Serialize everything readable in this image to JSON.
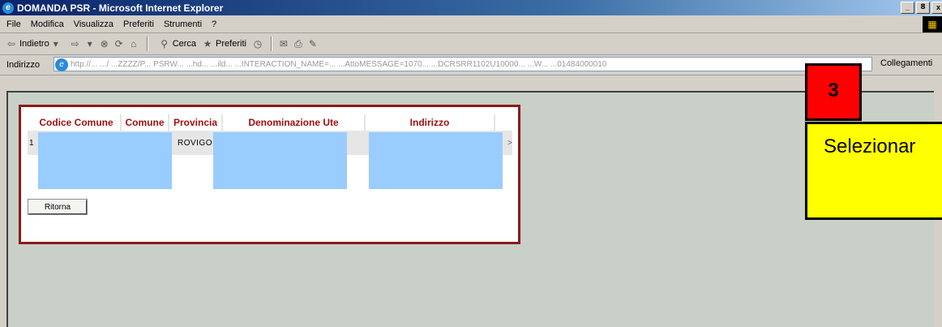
{
  "window": {
    "title": "DOMANDA PSR - Microsoft Internet Explorer",
    "controls": [
      "_",
      "8",
      "x"
    ]
  },
  "menu": [
    "File",
    "Modifica",
    "Visualizza",
    "Preferiti",
    "Strumenti",
    "?"
  ],
  "toolbar": {
    "back": "Indietro",
    "search": "Cerca",
    "favorites": "Preferiti"
  },
  "address": {
    "label": "Indirizzo",
    "value": "http://...  .../  ...ZZZZ/P...  PSRW...  ...hd...  ...ild...  ...INTERACTION_NAME=...  ...AttoMESSAGE=1070...  ...DCRSRR1102U10000...  ...W...  ...01484000010",
    "links": "Collegamenti"
  },
  "table": {
    "headers": [
      "Codice Comune",
      "Comune",
      "Provincia",
      "Denominazione Ute",
      "Indirizzo"
    ],
    "row": {
      "num": "1",
      "provincia": "ROVIGO",
      "arrow": ">"
    }
  },
  "buttons": {
    "ritorna": "Ritorna"
  },
  "annotation": {
    "step": "3",
    "text": "Selezionar"
  },
  "colors": {
    "panel_border": "#8b1a1a",
    "header_text": "#a01010",
    "redacted": "#99ccff",
    "callout": "#ffff00",
    "step": "#ff0000"
  }
}
